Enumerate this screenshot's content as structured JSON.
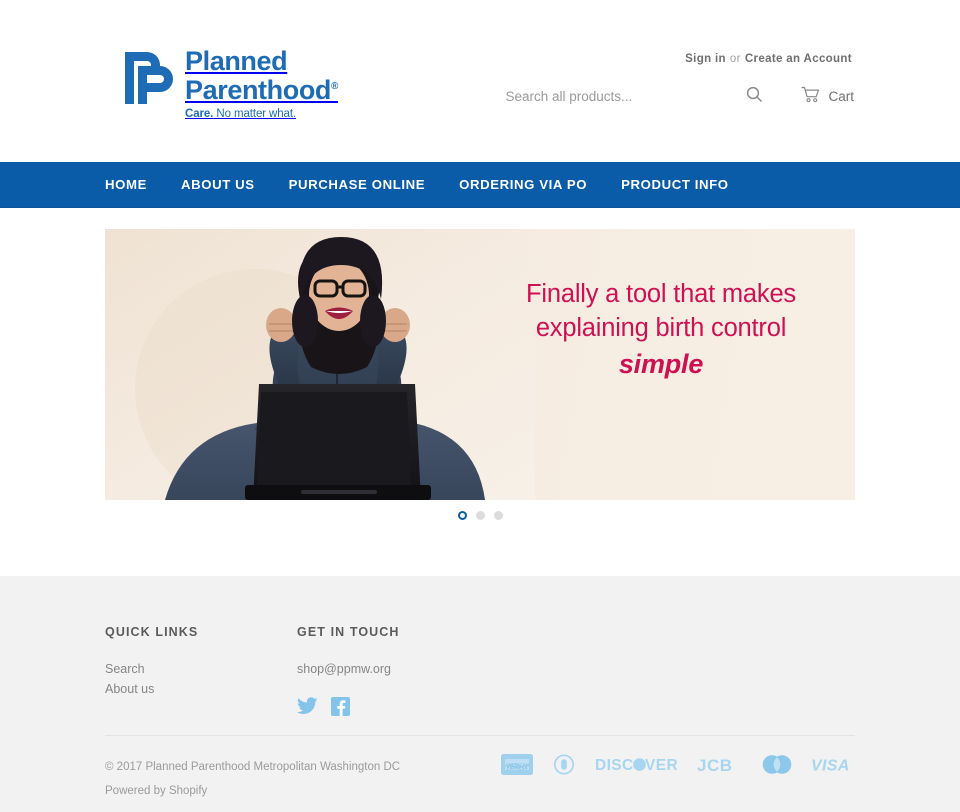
{
  "brand": {
    "logo_line1": "Planned",
    "logo_line2": "Parenthood",
    "registered_mark": "®",
    "tagline_bold": "Care.",
    "tagline_rest": " No matter what.",
    "logo_color": "#1d6cb5",
    "logo_icon": "planned-parenthood-monogram-icon"
  },
  "account": {
    "sign_in": "Sign in",
    "or": "or",
    "create_account": "Create an Account"
  },
  "search": {
    "placeholder": "Search all products...",
    "value": "",
    "icon": "search-icon",
    "submit_label": "Search"
  },
  "cart": {
    "label": "Cart",
    "icon": "shopping-cart-icon"
  },
  "nav": {
    "background": "#0a5ba8",
    "items": [
      {
        "label": "HOME"
      },
      {
        "label": "ABOUT US"
      },
      {
        "label": "PURCHASE ONLINE"
      },
      {
        "label": "ORDERING VIA PO"
      },
      {
        "label": "PRODUCT INFO"
      }
    ]
  },
  "hero": {
    "headline_line1": "Finally a tool that makes",
    "headline_line2": "explaining birth control",
    "headline_emphasis": "simple",
    "text_color": "#cf1154",
    "background_color": "#f5ebe0",
    "image_alt": "Woman with glasses celebrating in front of a laptop",
    "slides": [
      {
        "active": true
      },
      {
        "active": false
      },
      {
        "active": false
      }
    ]
  },
  "footer": {
    "background": "#f2f2f2",
    "quick_links": {
      "title": "QUICK LINKS",
      "items": [
        {
          "label": "Search"
        },
        {
          "label": "About us"
        }
      ]
    },
    "get_in_touch": {
      "title": "GET IN TOUCH",
      "email": "shop@ppmw.org",
      "social": [
        {
          "name": "twitter-icon",
          "label": "Twitter"
        },
        {
          "name": "facebook-icon",
          "label": "Facebook"
        }
      ]
    },
    "copyright": "© 2017 Planned Parenthood Metropolitan Washington DC",
    "powered_by_prefix": "Powered by ",
    "powered_by_link": "Shopify",
    "payment_methods": [
      {
        "name": "american-express-icon",
        "label": "American Express"
      },
      {
        "name": "diners-club-icon",
        "label": "Diners Club"
      },
      {
        "name": "discover-icon",
        "label": "Discover"
      },
      {
        "name": "jcb-icon",
        "label": "JCB"
      },
      {
        "name": "mastercard-icon",
        "label": "Mastercard"
      },
      {
        "name": "visa-icon",
        "label": "Visa"
      }
    ]
  }
}
